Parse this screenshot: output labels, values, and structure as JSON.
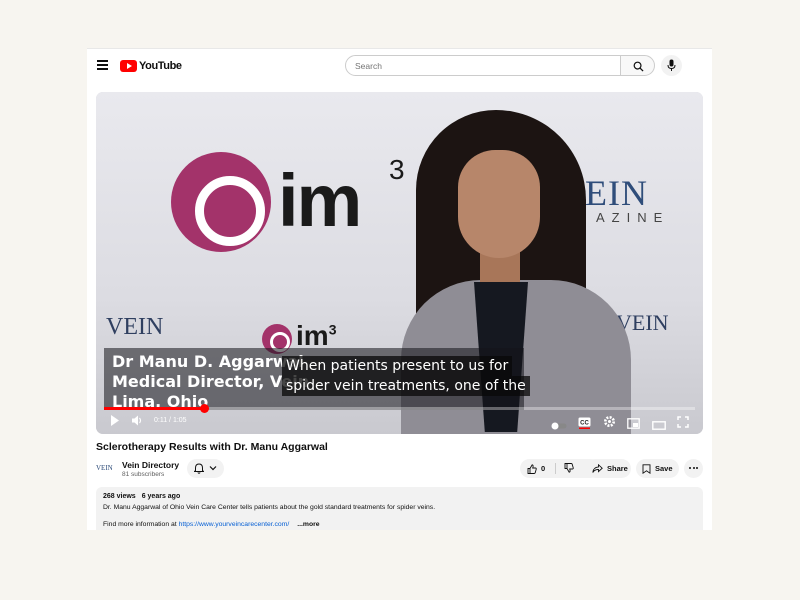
{
  "header": {
    "logo_text": "YouTube",
    "search_placeholder": "Search"
  },
  "player": {
    "background_signage": {
      "brand_big": "im",
      "brand_sup": "3",
      "vein_right": "VEIN",
      "magazine_fragment": "AZINE",
      "vein_small": "VEIN",
      "brand_small": "im",
      "brand_small_sup": "3",
      "vein_right_small": "VEIN"
    },
    "lower_third": {
      "name": "Dr Manu D. Aggarwal",
      "role": "Medical Director, Vein",
      "place": "Lima, Ohio"
    },
    "captions": [
      "When patients present to us for",
      "spider vein treatments, one of the"
    ],
    "time_display": "0:11 / 1:05",
    "progress_fraction": 0.169,
    "accent_color": "#ff0000"
  },
  "video": {
    "title": "Sclerotherapy Results with Dr. Manu Aggarwal"
  },
  "channel": {
    "avatar_text": "VEIN",
    "name": "Vein Directory",
    "subscribers": "81 subscribers"
  },
  "actions": {
    "likes": "0",
    "share_label": "Share",
    "save_label": "Save"
  },
  "description": {
    "views": "268 views",
    "age": "6 years ago",
    "text": "Dr. Manu Aggarwal of Ohio Vein Care Center tells patients about the gold standard treatments for spider veins.",
    "find_prefix": "Find more information at ",
    "link": "https://www.yourveincarecenter.com/",
    "more_label": "...more"
  },
  "icons": [
    "menu-icon",
    "youtube-logo-icon",
    "search-icon",
    "microphone-icon",
    "play-icon",
    "volume-icon",
    "autoplay-toggle-icon",
    "captions-icon",
    "settings-icon",
    "miniplayer-icon",
    "theater-mode-icon",
    "fullscreen-icon",
    "bell-icon",
    "chevron-down-icon",
    "thumbs-up-icon",
    "thumbs-down-icon",
    "share-icon",
    "save-icon",
    "more-icon"
  ]
}
